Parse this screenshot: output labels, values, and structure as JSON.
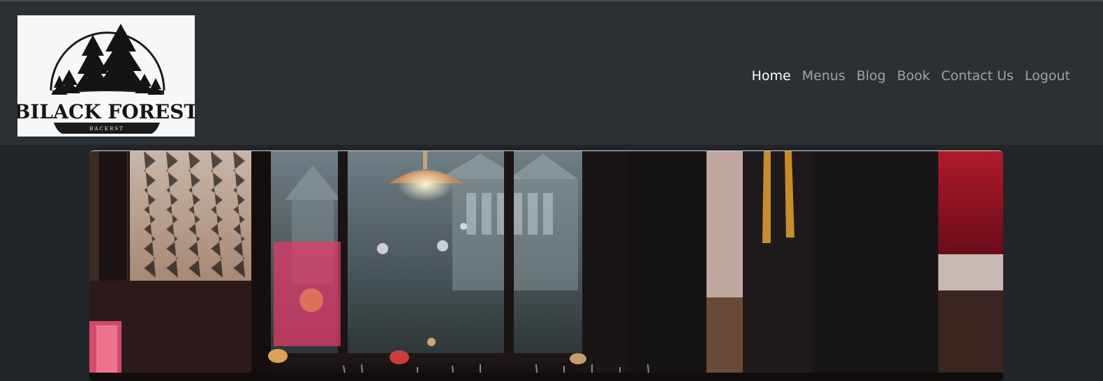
{
  "header": {
    "logo": {
      "title": "BILACK FOREST",
      "tagline": "BACKRST",
      "icon": "pine-trees-logo"
    },
    "nav": [
      {
        "label": "Home",
        "active": true
      },
      {
        "label": "Menus",
        "active": false
      },
      {
        "label": "Blog",
        "active": false
      },
      {
        "label": "Book",
        "active": false
      },
      {
        "label": "Contact Us",
        "active": false
      },
      {
        "label": "Logout",
        "active": false
      }
    ]
  },
  "hero": {
    "image": "restaurant-interior-photo"
  },
  "colors": {
    "page_bg": "#212529",
    "navbar_bg": "#2b3035",
    "nav_active": "#ffffff",
    "nav_inactive": "#9ea2a6"
  }
}
